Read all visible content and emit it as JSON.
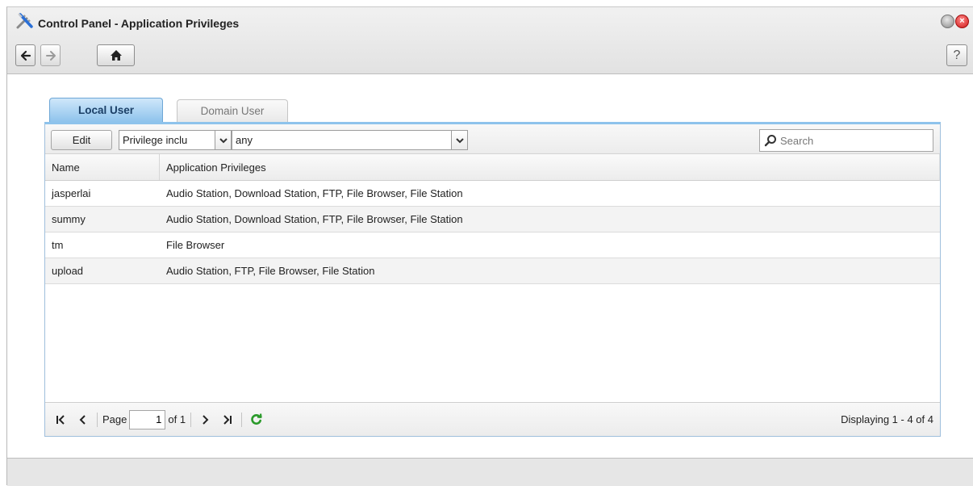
{
  "window": {
    "title": "Control Panel - Application Privileges",
    "app_icon": "tools-icon"
  },
  "nav": {
    "back_icon": "arrow-left-icon",
    "forward_icon": "arrow-right-icon",
    "home_icon": "home-icon",
    "help_label": "?"
  },
  "tabs": [
    {
      "label": "Local User",
      "active": true
    },
    {
      "label": "Domain User",
      "active": false
    }
  ],
  "toolbar": {
    "edit_label": "Edit",
    "filter_field": "Privilege inclu",
    "filter_value": "any",
    "search_placeholder": "Search"
  },
  "grid": {
    "columns": [
      "Name",
      "Application Privileges"
    ],
    "rows": [
      {
        "name": "jasperlai",
        "privileges": "Audio Station, Download Station, FTP, File Browser, File Station"
      },
      {
        "name": "summy",
        "privileges": "Audio Station, Download Station, FTP, File Browser, File Station"
      },
      {
        "name": "tm",
        "privileges": "File Browser"
      },
      {
        "name": "upload",
        "privileges": "Audio Station, FTP, File Browser, File Station"
      }
    ]
  },
  "pager": {
    "page_label": "Page",
    "page_value": "1",
    "of_label": "of 1",
    "display_info": "Displaying 1 - 4 of 4"
  },
  "colors": {
    "active_tab": "#8ec3ec",
    "close_button": "#d01818",
    "refresh": "#2a9a2a"
  }
}
